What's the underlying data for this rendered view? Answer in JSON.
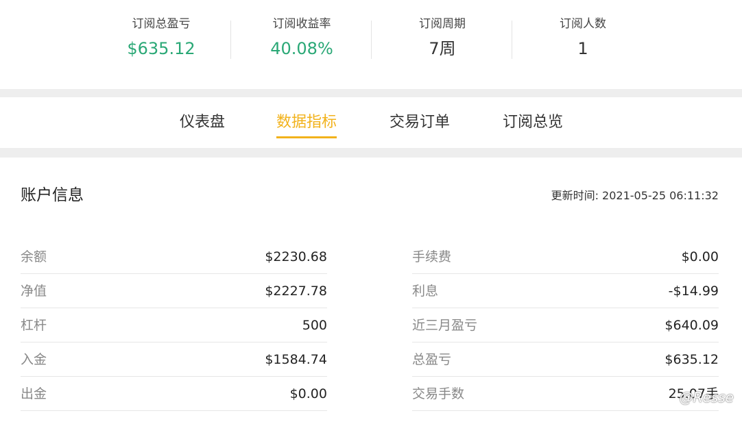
{
  "summary": {
    "items": [
      {
        "label": "订阅总盈亏",
        "value": "$635.12",
        "color": "#2aa876"
      },
      {
        "label": "订阅收益率",
        "value": "40.08%",
        "color": "#2aa876"
      },
      {
        "label": "订阅周期",
        "value": "7周"
      },
      {
        "label": "订阅人数",
        "value": "1"
      }
    ]
  },
  "tabs": {
    "items": [
      {
        "label": "仪表盘"
      },
      {
        "label": "数据指标",
        "active": true
      },
      {
        "label": "交易订单"
      },
      {
        "label": "订阅总览"
      }
    ],
    "active_color": "#f2b21b"
  },
  "account": {
    "title": "账户信息",
    "update_time": "更新时间: 2021-05-25 06:11:32",
    "left": [
      {
        "key": "余额",
        "value": "$2230.68"
      },
      {
        "key": "净值",
        "value": "$2227.78"
      },
      {
        "key": "杠杆",
        "value": "500"
      },
      {
        "key": "入金",
        "value": "$1584.74"
      },
      {
        "key": "出金",
        "value": "$0.00"
      }
    ],
    "right": [
      {
        "key": "手续费",
        "value": "$0.00"
      },
      {
        "key": "利息",
        "value": "-$14.99"
      },
      {
        "key": "近三月盈亏",
        "value": "$640.09"
      },
      {
        "key": "总盈亏",
        "value": "$635.12"
      },
      {
        "key": "交易手数",
        "value": "25.07手"
      }
    ]
  },
  "watermark": "@Resse"
}
